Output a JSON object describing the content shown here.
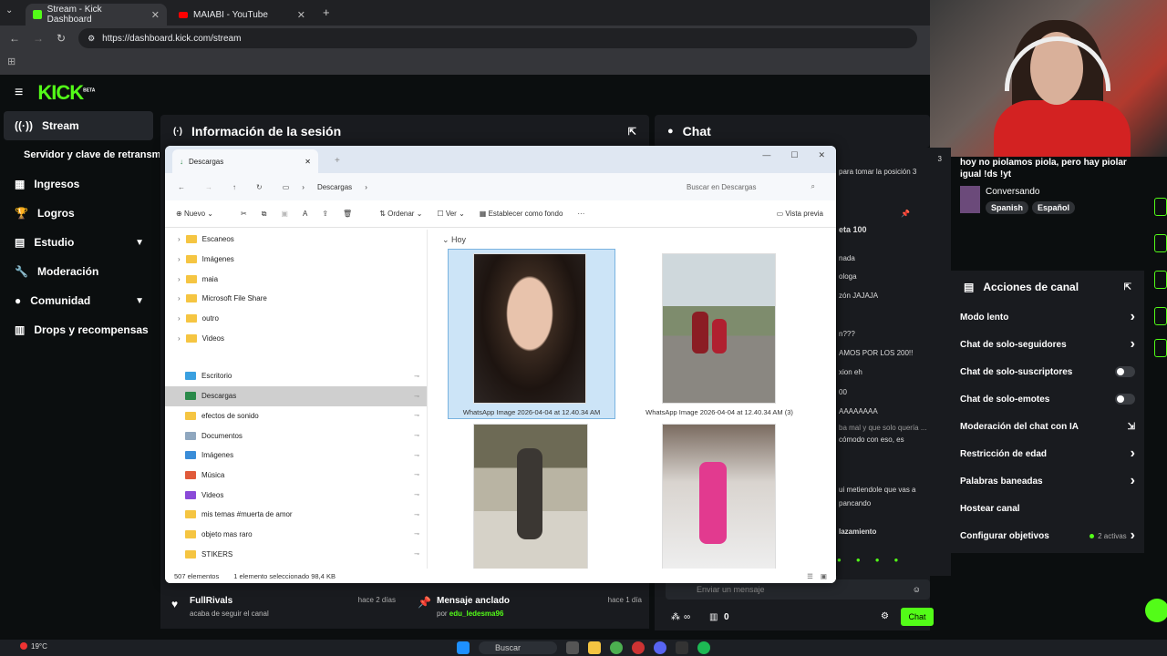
{
  "browser": {
    "tabs": [
      {
        "title": "Stream - Kick Dashboard"
      },
      {
        "title": "MAIABI - YouTube"
      }
    ],
    "url": "https://dashboard.kick.com/stream"
  },
  "kick": {
    "logo": "KICK",
    "logo_badge": "BETA",
    "sidebar": [
      {
        "label": "Stream"
      },
      {
        "label": "Servidor y clave de retransmisión"
      },
      {
        "label": "Ingresos"
      },
      {
        "label": "Logros"
      },
      {
        "label": "Estudio"
      },
      {
        "label": "Moderación"
      },
      {
        "label": "Comunidad"
      },
      {
        "label": "Drops y recompensas"
      }
    ],
    "session_title": "Información de la sesión",
    "chat_title": "Chat",
    "chat_partial": [
      "para tomar la posición 3",
      "eta 100",
      "nada",
      "ologa",
      "zón JAJAJA",
      "n???",
      "AMOS POR LOS 200!!",
      "xion eh",
      "00",
      "AAAAAAAA",
      "ba mal y que solo quería ...",
      "cómodo con eso, es",
      "ui metiendole que vas a",
      "pancando",
      "lazamiento"
    ],
    "chat_counter": "3",
    "activity": {
      "user": "FullRivals",
      "time": "hace 2 días",
      "text": "acaba de seguir el canal"
    },
    "pinned": {
      "title": "Mensaje anclado",
      "time": "hace 1 día",
      "by_prefix": "por",
      "by_user": "edu_ledesma96"
    },
    "chat_input_placeholder": "Enviar un mensaje",
    "chat_button": "Chat",
    "chat_count": "0",
    "infinity": "∞"
  },
  "overlay": {
    "message": "hoy no piolamos piola, pero hay piolar igual !ds !yt",
    "category": "Conversando",
    "tags": [
      "Spanish",
      "Español"
    ]
  },
  "channel_actions": {
    "title": "Acciones de canal",
    "items": [
      {
        "label": "Modo lento",
        "type": "chevron"
      },
      {
        "label": "Chat de solo-seguidores",
        "type": "chevron"
      },
      {
        "label": "Chat de solo-suscriptores",
        "type": "toggle"
      },
      {
        "label": "Chat de solo-emotes",
        "type": "toggle"
      },
      {
        "label": "Moderación del chat con IA",
        "type": "external"
      },
      {
        "label": "Restricción de edad",
        "type": "chevron"
      },
      {
        "label": "Palabras baneadas",
        "type": "chevron"
      },
      {
        "label": "Hostear canal",
        "type": "none"
      },
      {
        "label": "Configurar objetivos",
        "type": "chevron",
        "badge": "2 activas"
      }
    ]
  },
  "explorer": {
    "tab_title": "Descargas",
    "crumb": "Descargas",
    "search_placeholder": "Buscar en Descargas",
    "commands": {
      "new": "Nuevo",
      "sort": "Ordenar",
      "view": "Ver",
      "wallpaper": "Establecer como fondo",
      "preview": "Vista previa"
    },
    "tree_top": [
      "Escaneos",
      "Imágenes",
      "maia",
      "Microsoft File Share",
      "outro",
      "Videos"
    ],
    "tree_quick": [
      {
        "label": "Escritorio",
        "icon": "desktop"
      },
      {
        "label": "Descargas",
        "icon": "download",
        "selected": true
      },
      {
        "label": "efectos de sonido",
        "icon": "folder"
      },
      {
        "label": "Documentos",
        "icon": "doc"
      },
      {
        "label": "Imágenes",
        "icon": "image"
      },
      {
        "label": "Música",
        "icon": "music"
      },
      {
        "label": "Videos",
        "icon": "video"
      },
      {
        "label": "mis temas #muerta de amor",
        "icon": "folder"
      },
      {
        "label": "objeto mas raro",
        "icon": "folder"
      },
      {
        "label": "STIKERS",
        "icon": "folder"
      }
    ],
    "group_label": "Hoy",
    "files": [
      {
        "name": "WhatsApp Image 2026-04-04 at 12.40.34 AM"
      },
      {
        "name": "WhatsApp Image 2026-04-04 at 12.40.34 AM (3)"
      },
      {
        "name": ""
      },
      {
        "name": ""
      }
    ],
    "status": {
      "count": "507 elementos",
      "selected": "1 elemento seleccionado 98,4 KB"
    }
  },
  "taskbar": {
    "temp": "19°C",
    "search": "Buscar"
  }
}
